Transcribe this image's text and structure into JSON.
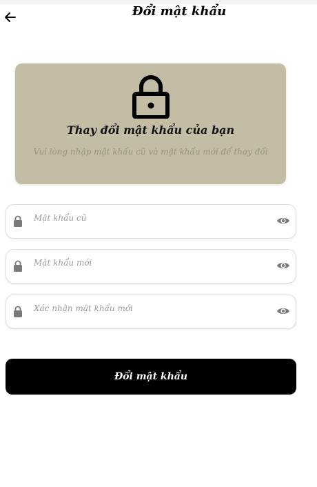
{
  "header": {
    "title": "Đổi mật khẩu",
    "back_icon": "arrow-left-icon"
  },
  "info_card": {
    "icon": "lock-icon",
    "title": "Thay đổi mật khẩu của bạn",
    "subtitle": "Vui lòng nhập mật khẩu cũ và mật khẩu mới để thay đổi",
    "background_color": "#c3bda6"
  },
  "form": {
    "fields": [
      {
        "placeholder": "Mật khẩu cũ",
        "leading_icon": "lock-icon",
        "trailing_icon": "eye-icon"
      },
      {
        "placeholder": "Mật khẩu mới",
        "leading_icon": "lock-icon",
        "trailing_icon": "eye-icon"
      },
      {
        "placeholder": "Xác nhận mật khẩu mới",
        "leading_icon": "lock-icon",
        "trailing_icon": "eye-icon"
      }
    ],
    "submit_label": "Đổi mật khẩu",
    "submit_color": "#000000"
  }
}
